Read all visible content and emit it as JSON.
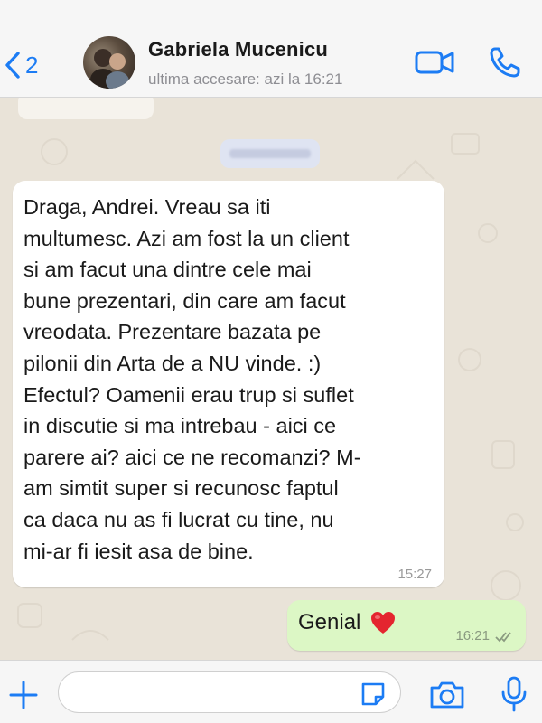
{
  "header": {
    "back_count": "2",
    "contact_name": "Gabriela Mucenicu",
    "last_seen": "ultima accesare: azi la 16:21"
  },
  "messages": [
    {
      "direction": "incoming",
      "lines": [
        "Draga, Andrei. Vreau sa iti",
        "multumesc. Azi am fost la un client",
        "si am facut una dintre cele mai",
        "bune prezentari, din care am facut",
        "vreodata. Prezentare bazata pe",
        "pilonii din Arta de a NU vinde. :)",
        "Efectul? Oamenii erau trup si suflet",
        "in discutie si ma intrebau - aici ce",
        "parere ai? aici ce ne recomanzi? M-",
        "am simtit super si recunosc faptul",
        "ca daca nu as fi lucrat cu tine, nu",
        "mi-ar fi iesit asa de bine."
      ],
      "time": "15:27"
    },
    {
      "direction": "outgoing",
      "text": "Genial",
      "emoji": "heart-emoji",
      "time": "16:21",
      "status": "read-ticks"
    }
  ],
  "composer": {
    "placeholder": ""
  },
  "icons": {
    "back": "chevron-left-icon",
    "video": "video-camera-icon",
    "call": "phone-icon",
    "plus": "plus-icon",
    "sticker": "sticker-icon",
    "camera": "camera-icon",
    "mic": "microphone-icon"
  },
  "colors": {
    "accent": "#1c7cf4",
    "outgoing_bubble": "#dcf7c5",
    "incoming_bubble": "#ffffff",
    "heart": "#e4252f",
    "wallpaper": "#e9e3d8"
  }
}
